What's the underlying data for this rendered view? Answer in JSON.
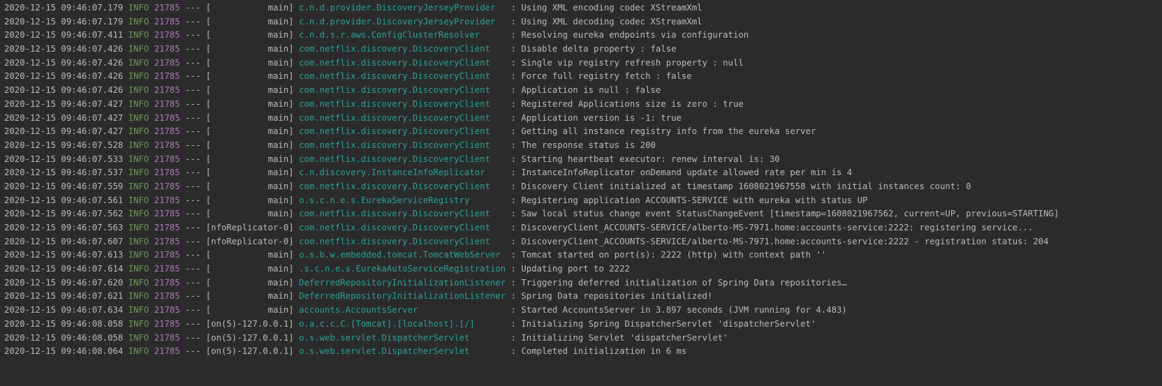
{
  "colors": {
    "background": "#2b2b2b",
    "text": "#bbbbbb",
    "level_info": "#6a9955",
    "pid": "#b07ab8",
    "logger": "#2aa198"
  },
  "log_lines": [
    {
      "timestamp": "2020-12-15 09:46:07.179",
      "level": "INFO",
      "pid": "21785",
      "sep": "---",
      "thread": "[           main]",
      "logger": "c.n.d.provider.DiscoveryJerseyProvider  ",
      "message": ": Using XML encoding codec XStreamXml"
    },
    {
      "timestamp": "2020-12-15 09:46:07.179",
      "level": "INFO",
      "pid": "21785",
      "sep": "---",
      "thread": "[           main]",
      "logger": "c.n.d.provider.DiscoveryJerseyProvider  ",
      "message": ": Using XML decoding codec XStreamXml"
    },
    {
      "timestamp": "2020-12-15 09:46:07.411",
      "level": "INFO",
      "pid": "21785",
      "sep": "---",
      "thread": "[           main]",
      "logger": "c.n.d.s.r.aws.ConfigClusterResolver     ",
      "message": ": Resolving eureka endpoints via configuration"
    },
    {
      "timestamp": "2020-12-15 09:46:07.426",
      "level": "INFO",
      "pid": "21785",
      "sep": "---",
      "thread": "[           main]",
      "logger": "com.netflix.discovery.DiscoveryClient   ",
      "message": ": Disable delta property : false"
    },
    {
      "timestamp": "2020-12-15 09:46:07.426",
      "level": "INFO",
      "pid": "21785",
      "sep": "---",
      "thread": "[           main]",
      "logger": "com.netflix.discovery.DiscoveryClient   ",
      "message": ": Single vip registry refresh property : null"
    },
    {
      "timestamp": "2020-12-15 09:46:07.426",
      "level": "INFO",
      "pid": "21785",
      "sep": "---",
      "thread": "[           main]",
      "logger": "com.netflix.discovery.DiscoveryClient   ",
      "message": ": Force full registry fetch : false"
    },
    {
      "timestamp": "2020-12-15 09:46:07.426",
      "level": "INFO",
      "pid": "21785",
      "sep": "---",
      "thread": "[           main]",
      "logger": "com.netflix.discovery.DiscoveryClient   ",
      "message": ": Application is null : false"
    },
    {
      "timestamp": "2020-12-15 09:46:07.427",
      "level": "INFO",
      "pid": "21785",
      "sep": "---",
      "thread": "[           main]",
      "logger": "com.netflix.discovery.DiscoveryClient   ",
      "message": ": Registered Applications size is zero : true"
    },
    {
      "timestamp": "2020-12-15 09:46:07.427",
      "level": "INFO",
      "pid": "21785",
      "sep": "---",
      "thread": "[           main]",
      "logger": "com.netflix.discovery.DiscoveryClient   ",
      "message": ": Application version is -1: true"
    },
    {
      "timestamp": "2020-12-15 09:46:07.427",
      "level": "INFO",
      "pid": "21785",
      "sep": "---",
      "thread": "[           main]",
      "logger": "com.netflix.discovery.DiscoveryClient   ",
      "message": ": Getting all instance registry info from the eureka server"
    },
    {
      "timestamp": "2020-12-15 09:46:07.528",
      "level": "INFO",
      "pid": "21785",
      "sep": "---",
      "thread": "[           main]",
      "logger": "com.netflix.discovery.DiscoveryClient   ",
      "message": ": The response status is 200"
    },
    {
      "timestamp": "2020-12-15 09:46:07.533",
      "level": "INFO",
      "pid": "21785",
      "sep": "---",
      "thread": "[           main]",
      "logger": "com.netflix.discovery.DiscoveryClient   ",
      "message": ": Starting heartbeat executor: renew interval is: 30"
    },
    {
      "timestamp": "2020-12-15 09:46:07.537",
      "level": "INFO",
      "pid": "21785",
      "sep": "---",
      "thread": "[           main]",
      "logger": "c.n.discovery.InstanceInfoReplicator    ",
      "message": ": InstanceInfoReplicator onDemand update allowed rate per min is 4"
    },
    {
      "timestamp": "2020-12-15 09:46:07.559",
      "level": "INFO",
      "pid": "21785",
      "sep": "---",
      "thread": "[           main]",
      "logger": "com.netflix.discovery.DiscoveryClient   ",
      "message": ": Discovery Client initialized at timestamp 1608021967558 with initial instances count: 0"
    },
    {
      "timestamp": "2020-12-15 09:46:07.561",
      "level": "INFO",
      "pid": "21785",
      "sep": "---",
      "thread": "[           main]",
      "logger": "o.s.c.n.e.s.EurekaServiceRegistry       ",
      "message": ": Registering application ACCOUNTS-SERVICE with eureka with status UP"
    },
    {
      "timestamp": "2020-12-15 09:46:07.562",
      "level": "INFO",
      "pid": "21785",
      "sep": "---",
      "thread": "[           main]",
      "logger": "com.netflix.discovery.DiscoveryClient   ",
      "message": ": Saw local status change event StatusChangeEvent [timestamp=1608021967562, current=UP, previous=STARTING]"
    },
    {
      "timestamp": "2020-12-15 09:46:07.563",
      "level": "INFO",
      "pid": "21785",
      "sep": "---",
      "thread": "[nfoReplicator-0]",
      "logger": "com.netflix.discovery.DiscoveryClient   ",
      "message": ": DiscoveryClient_ACCOUNTS-SERVICE/alberto-MS-7971.home:accounts-service:2222: registering service..."
    },
    {
      "timestamp": "2020-12-15 09:46:07.607",
      "level": "INFO",
      "pid": "21785",
      "sep": "---",
      "thread": "[nfoReplicator-0]",
      "logger": "com.netflix.discovery.DiscoveryClient   ",
      "message": ": DiscoveryClient_ACCOUNTS-SERVICE/alberto-MS-7971.home:accounts-service:2222 - registration status: 204"
    },
    {
      "timestamp": "2020-12-15 09:46:07.613",
      "level": "INFO",
      "pid": "21785",
      "sep": "---",
      "thread": "[           main]",
      "logger": "o.s.b.w.embedded.tomcat.TomcatWebServer ",
      "message": ": Tomcat started on port(s): 2222 (http) with context path ''"
    },
    {
      "timestamp": "2020-12-15 09:46:07.614",
      "level": "INFO",
      "pid": "21785",
      "sep": "---",
      "thread": "[           main]",
      "logger": ".s.c.n.e.s.EurekaAutoServiceRegistration",
      "message": ": Updating port to 2222"
    },
    {
      "timestamp": "2020-12-15 09:46:07.620",
      "level": "INFO",
      "pid": "21785",
      "sep": "---",
      "thread": "[           main]",
      "logger": "DeferredRepositoryInitializationListener",
      "message": ": Triggering deferred initialization of Spring Data repositories…"
    },
    {
      "timestamp": "2020-12-15 09:46:07.621",
      "level": "INFO",
      "pid": "21785",
      "sep": "---",
      "thread": "[           main]",
      "logger": "DeferredRepositoryInitializationListener",
      "message": ": Spring Data repositories initialized!"
    },
    {
      "timestamp": "2020-12-15 09:46:07.634",
      "level": "INFO",
      "pid": "21785",
      "sep": "---",
      "thread": "[           main]",
      "logger": "accounts.AccountsServer                 ",
      "message": ": Started AccountsServer in 3.897 seconds (JVM running for 4.483)"
    },
    {
      "timestamp": "2020-12-15 09:46:08.058",
      "level": "INFO",
      "pid": "21785",
      "sep": "---",
      "thread": "[on(5)-127.0.0.1]",
      "logger": "o.a.c.c.C.[Tomcat].[localhost].[/]      ",
      "message": ": Initializing Spring DispatcherServlet 'dispatcherServlet'"
    },
    {
      "timestamp": "2020-12-15 09:46:08.058",
      "level": "INFO",
      "pid": "21785",
      "sep": "---",
      "thread": "[on(5)-127.0.0.1]",
      "logger": "o.s.web.servlet.DispatcherServlet       ",
      "message": ": Initializing Servlet 'dispatcherServlet'"
    },
    {
      "timestamp": "2020-12-15 09:46:08.064",
      "level": "INFO",
      "pid": "21785",
      "sep": "---",
      "thread": "[on(5)-127.0.0.1]",
      "logger": "o.s.web.servlet.DispatcherServlet       ",
      "message": ": Completed initialization in 6 ms"
    }
  ]
}
